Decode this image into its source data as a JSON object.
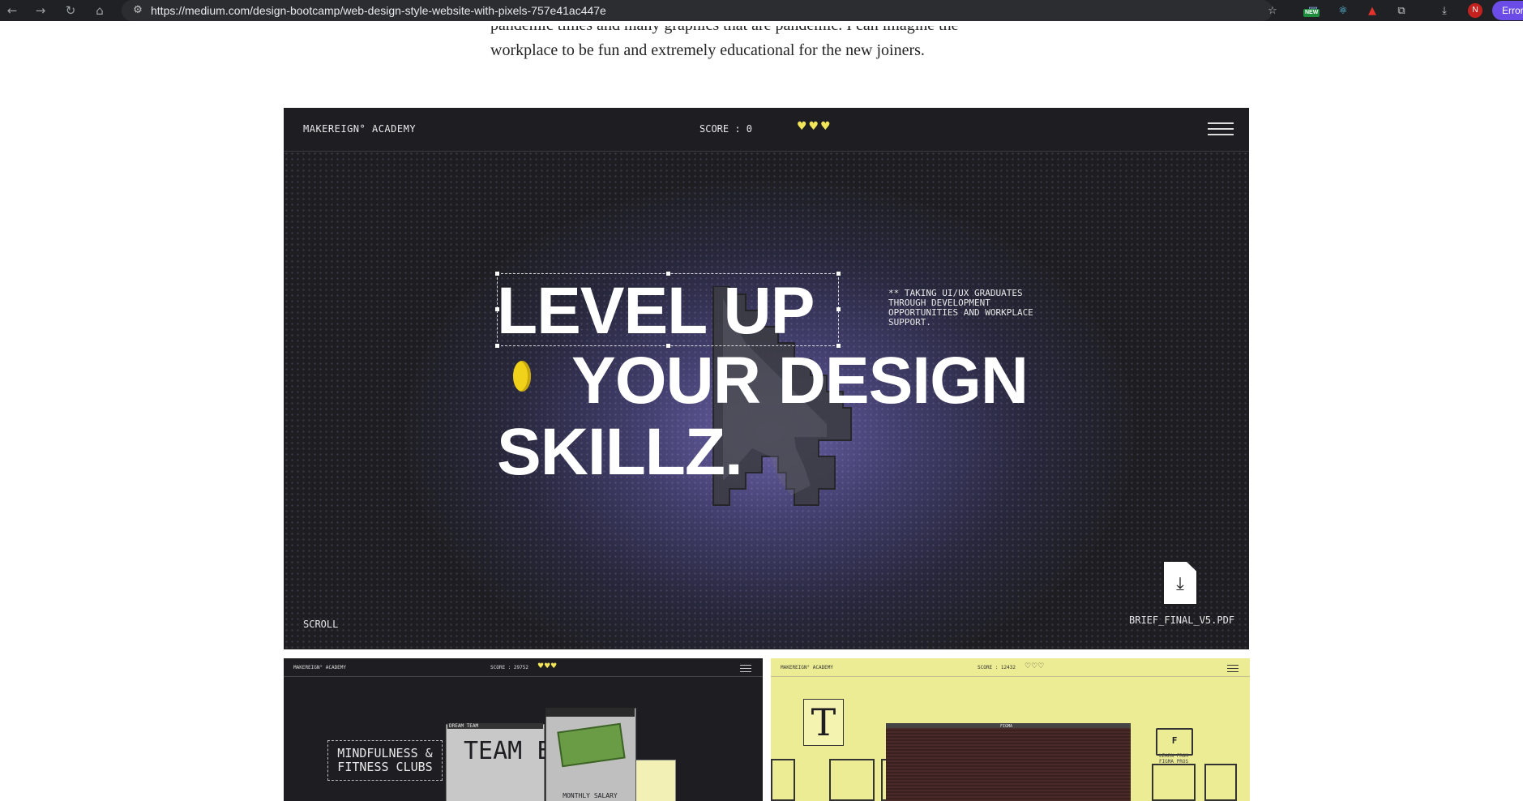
{
  "browser": {
    "url": "https://medium.com/design-bootcamp/web-design-style-website-with-pixels-757e41ac447e",
    "new_badge": "NEW",
    "profile_initial": "N",
    "error_label": "Error",
    "icons": [
      "back-icon",
      "forward-icon",
      "reload-icon",
      "home-icon",
      "site-info-icon",
      "star-icon",
      "extension-new-icon",
      "react-devtools-icon",
      "pdf-icon",
      "puzzle-icon",
      "download-icon"
    ]
  },
  "article": {
    "line_1_partial": "pandemic times and many graphics that are pandemic. I can imagine the",
    "line_2": "workplace to be fun and extremely educational for the new joiners."
  },
  "hero": {
    "brand": "MAKEREIGN° ACADEMY",
    "score": "SCORE : 0",
    "hearts": "♥♥♥",
    "headline_1": "LEVEL UP",
    "headline_2": "YOUR DESIGN",
    "headline_3": "SKILLZ.",
    "blurb": "** TAKING UI/UX GRADUATES THROUGH DEVELOPMENT OPPORTUNITIES AND WORKPLACE SUPPORT.",
    "scroll": "SCROLL",
    "file_name": "BRIEF_FINAL_V5.PDF",
    "colors": {
      "background": "#1e1e22",
      "glow": "#786ebe",
      "coin": "#f0d21a",
      "hearts": "#f2e55a"
    }
  },
  "thumb_left": {
    "brand": "MAKEREIGN° ACADEMY",
    "score": "SCORE : 29752",
    "hearts": "♥♥♥",
    "fitness": "MINDFULNESS & FITNESS CLUBS",
    "team_window_title": "DREAM TEAM",
    "team_text": "TEAM EVEN",
    "salary_label": "MONTHLY SALARY"
  },
  "thumb_right": {
    "brand": "MAKEREIGN° ACADEMY",
    "score": "SCORE : 12432",
    "hearts": "♡♡♡",
    "t_glyph": "T",
    "figma_label": "FIGMA",
    "folder_glyph": "F",
    "folder_label": "LEARN FROM FIGMA PROS",
    "colors": {
      "background": "#ecec94"
    }
  }
}
